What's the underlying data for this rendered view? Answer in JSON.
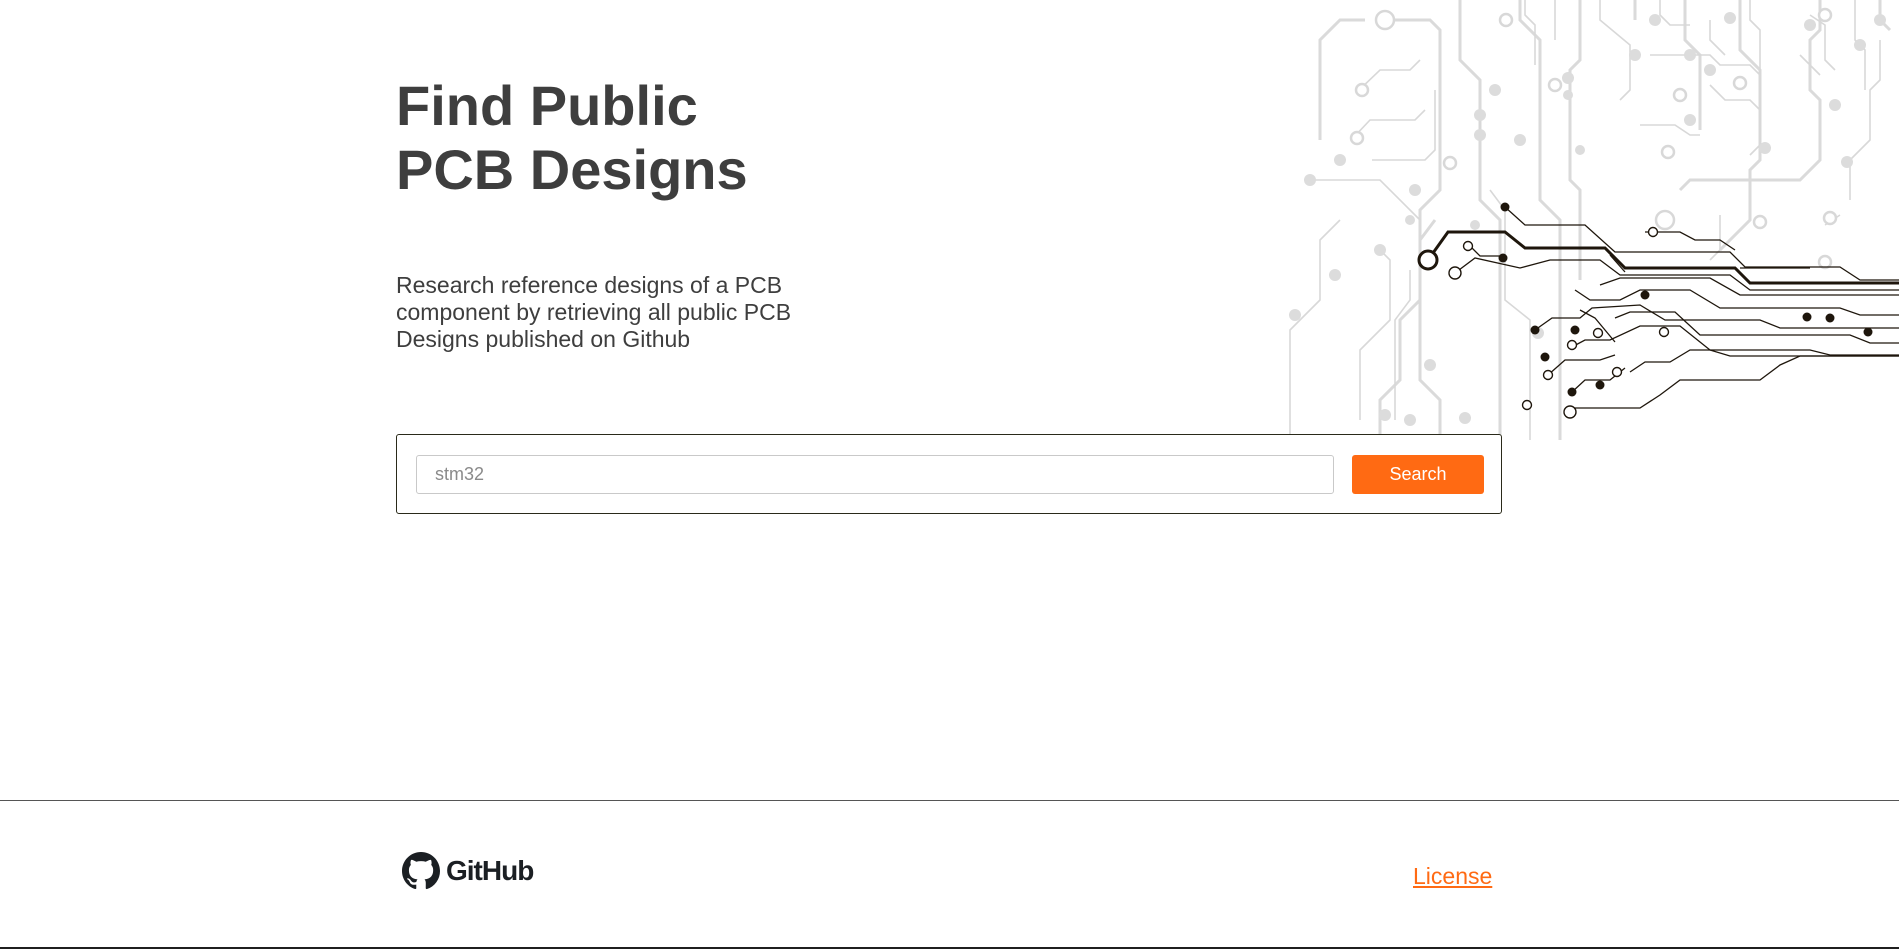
{
  "hero": {
    "title_line1": "Find Public",
    "title_line2": "PCB Designs",
    "description": "Research reference designs of a PCB component by retrieving all public PCB Designs published on Github"
  },
  "search": {
    "placeholder": "stm32",
    "value": "",
    "button_label": "Search"
  },
  "footer": {
    "github_label": "GitHub",
    "license_label": "License"
  },
  "colors": {
    "accent": "#ff6a13",
    "text": "#3e3e3e",
    "pcb_light": "#dcdcdc",
    "pcb_dark": "#1e160c"
  },
  "icons": {
    "github": "github-octocat-icon",
    "decoration": "pcb-circuit-traces"
  }
}
